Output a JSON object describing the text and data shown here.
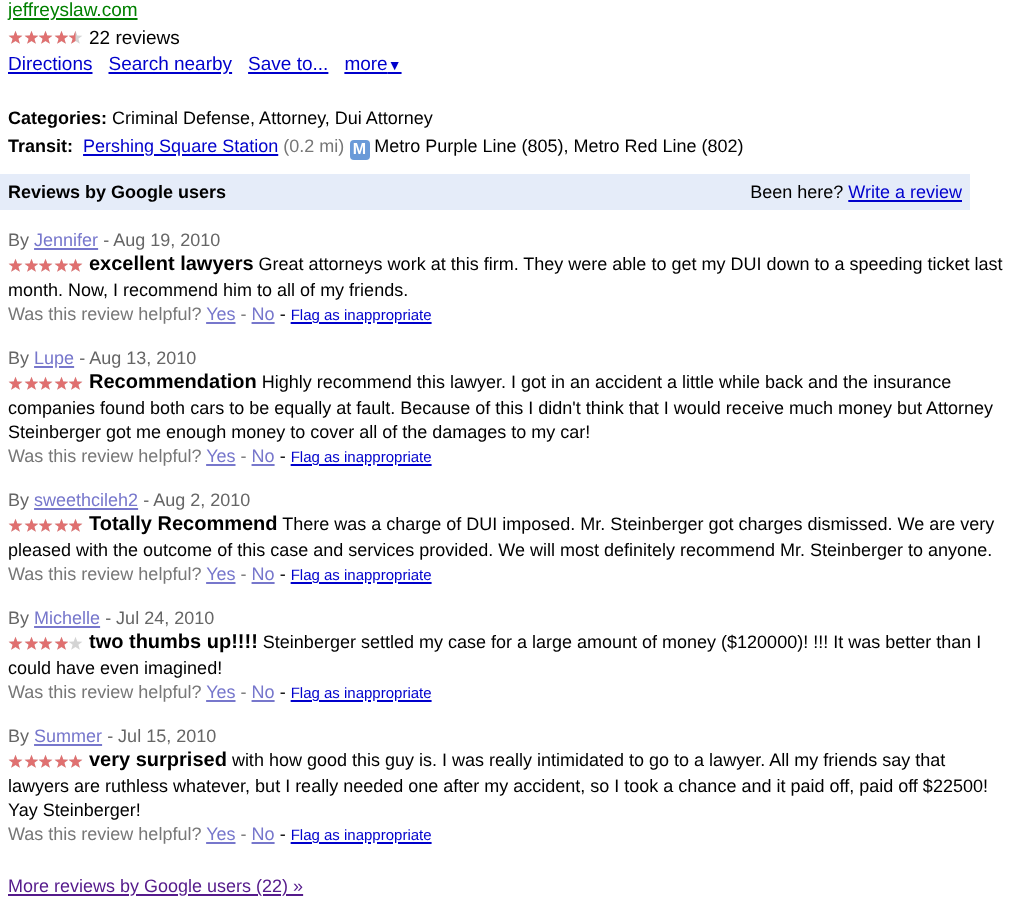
{
  "website": "jeffreyslaw.com",
  "rating": {
    "stars": 4.5,
    "count": "22 reviews"
  },
  "actions": [
    "Directions",
    "Search nearby",
    "Save to...",
    "more"
  ],
  "more_arrow": "▼",
  "categories": {
    "label": "Categories:",
    "value": "Criminal Defense, Attorney, Dui Attorney"
  },
  "transit": {
    "label": "Transit:",
    "station": "Pershing Square Station",
    "distance": "(0.2 mi)",
    "badge": "M",
    "lines": "Metro Purple Line (805), Metro Red Line (802)"
  },
  "reviews_header": {
    "title": "Reviews by Google users",
    "prompt": "Been here?",
    "link": "Write a review"
  },
  "reviews": [
    {
      "by": "By",
      "author": "Jennifer",
      "date": "- Aug 19, 2010",
      "stars": 5,
      "lines": [
        "**excellent lawyers** Great attorneys work at this firm. They were able to get my DUI down to a speeding ticket last",
        "month. Now, I recommend him to all of my friends."
      ],
      "helpful": "Was this review helpful?",
      "yes": "Yes",
      "no": "No",
      "flag": "Flag as inappropriate"
    },
    {
      "by": "By",
      "author": "Lupe",
      "date": "- Aug 13, 2010",
      "stars": 5,
      "lines": [
        "**Recommendation** Highly recommend this lawyer. I got in an accident a little while back and the insurance",
        "companies found both cars to be equally at fault. Because of this I didn't think that I would receive much money but Attorney",
        "Steinberger got me enough money to cover all of the damages to my car!"
      ],
      "helpful": "Was this review helpful?",
      "yes": "Yes",
      "no": "No",
      "flag": "Flag as inappropriate"
    },
    {
      "by": "By",
      "author": "sweethcileh2",
      "date": "- Aug 2, 2010",
      "stars": 5,
      "lines": [
        "**Totally Recommend** There was a charge of DUI imposed. Mr. Steinberger got charges dismissed. We are very",
        "pleased with the outcome of this case and services provided. We will most definitely recommend Mr. Steinberger to anyone."
      ],
      "helpful": "Was this review helpful?",
      "yes": "Yes",
      "no": "No",
      "flag": "Flag as inappropriate"
    },
    {
      "by": "By",
      "author": "Michelle",
      "date": "- Jul 24, 2010",
      "stars": 4,
      "lines": [
        "**two thumbs up!!!!** Steinberger settled my case for a large amount of money ($120000)! !!! It was better than I",
        "could have even imagined!"
      ],
      "helpful": "Was this review helpful?",
      "yes": "Yes",
      "no": "No",
      "flag": "Flag as inappropriate"
    },
    {
      "by": "By",
      "author": "Summer",
      "date": "- Jul 15, 2010",
      "stars": 5,
      "lines": [
        "**very surprised** with how good this guy is. I was really intimidated to go to a lawyer. All my friends say that",
        "lawyers are ruthless whatever, but I really needed one after my accident, so I took a chance and it paid off, paid off $22500!",
        "Yay Steinberger!"
      ],
      "helpful": "Was this review helpful?",
      "yes": "Yes",
      "no": "No",
      "flag": "Flag as inappropriate"
    }
  ],
  "separator": "-",
  "more_reviews": "More reviews by Google users (22) »"
}
